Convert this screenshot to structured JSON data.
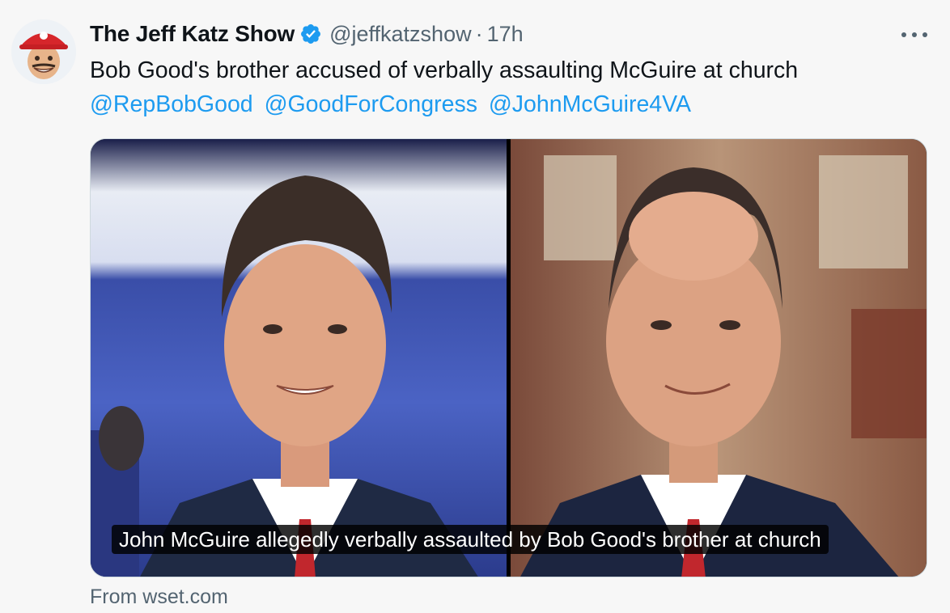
{
  "tweet": {
    "display_name": "The Jeff Katz Show",
    "handle": "@jeffkatzshow",
    "separator": "·",
    "time": "17h",
    "text": "Bob Good's brother accused of verbally assaulting McGuire at church",
    "mentions": [
      "@RepBobGood",
      "@GoodForCongress",
      "@JohnMcGuire4VA"
    ]
  },
  "media": {
    "caption": "John McGuire allegedly verbally assaulted by Bob Good's brother at church",
    "source": "From wset.com"
  },
  "colors": {
    "accent": "#1d9bf0",
    "secondary_text": "#536471",
    "background": "#f7f7f7"
  },
  "icons": {
    "verified": "verified-badge-icon",
    "more": "more-options-icon"
  }
}
